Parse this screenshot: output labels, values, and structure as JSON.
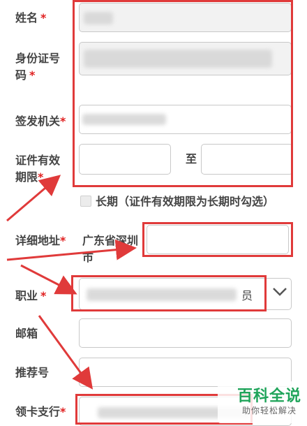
{
  "form": {
    "name_label": "姓名",
    "id_number_label_1": "身份证号",
    "id_number_label_2": "码",
    "issuer_label": "签发机关",
    "validity_label_1": "证件有效",
    "validity_label_2": "期限",
    "to_label": "至",
    "long_term_label": "长期（证件有效期限为长期时勾选）",
    "address_label": "详细地址",
    "address_prefix_1": "广东省深圳",
    "address_prefix_2": "市",
    "job_label": "职业",
    "email_label": "邮箱",
    "referral_label": "推荐号",
    "branch_label": "领卡支行",
    "required_mark": "*",
    "job_select_last_char": "员"
  },
  "watermark": {
    "main": "百科全说",
    "sub": "助你轻松解决"
  },
  "colors": {
    "required": "#e02020",
    "annotation_red": "#e03a3a",
    "watermark_green": "#1fa45a"
  }
}
